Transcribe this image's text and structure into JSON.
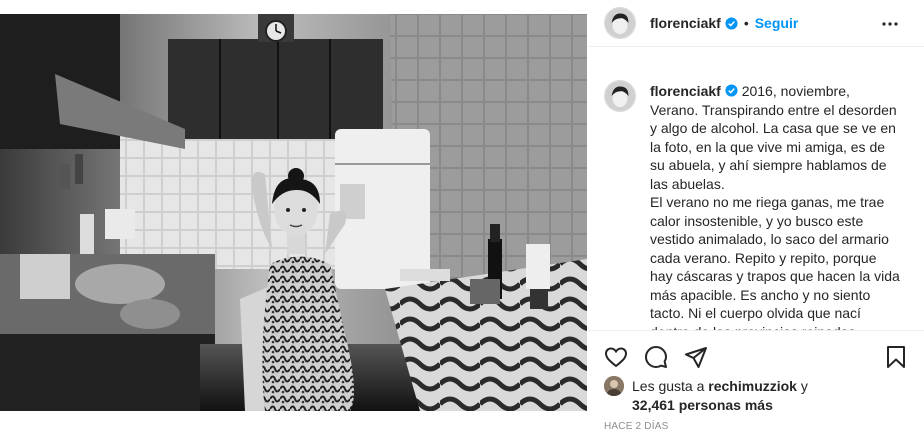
{
  "post": {
    "photo_icon": "kitchen-photo",
    "photo_clock": ""
  },
  "header": {
    "username": "florenciakf",
    "separator": "•",
    "follow_label": "Seguir",
    "verified_icon": "verified-badge-icon",
    "more_icon": "more-options-icon"
  },
  "caption": {
    "username": "florenciakf",
    "text": " 2016, noviembre,\nVerano. Transpirando entre el desorden y algo de alcohol. La casa que se ve en la foto, en la que vive mi amiga, es de su abuela, y ahí siempre hablamos de las abuelas.\nEl verano no me riega ganas, me trae calor insostenible, y yo busco este vestido animalado, lo saco del armario cada verano. Repito y repito, porque hay cáscaras y trapos que hacen la vida más apacible. Es ancho y no siento tacto. Ni el cuerpo olvida que nací dentro de las provincias reinadas"
  },
  "actions": {
    "like_icon": "heart-icon",
    "comment_icon": "comment-icon",
    "share_icon": "share-icon",
    "save_icon": "bookmark-icon"
  },
  "likes": {
    "prefix": "Les gusta a ",
    "user": "rechimuzziok",
    "connector": " y",
    "count": "32,461 personas más"
  },
  "timestamp": "HACE 2 DÍAS",
  "colors": {
    "accent": "#0095f6",
    "text": "#262626",
    "muted": "#8e8e8e",
    "border": "#efefef"
  }
}
